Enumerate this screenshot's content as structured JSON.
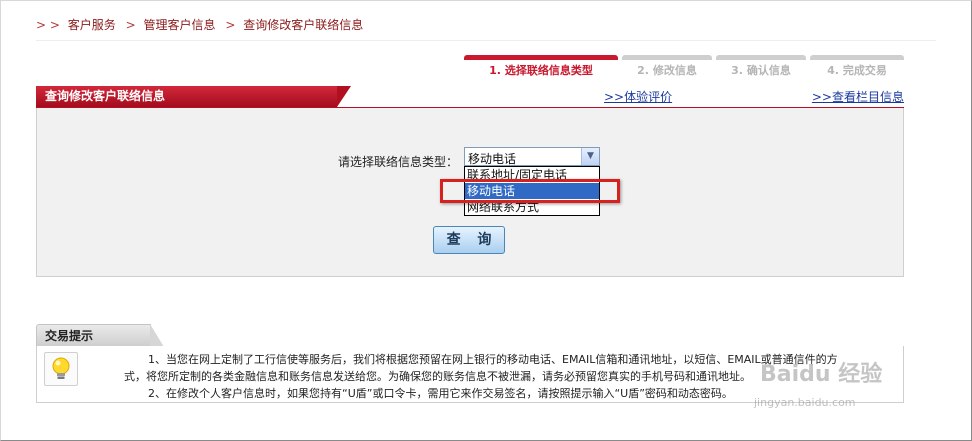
{
  "breadcrumb": {
    "prefix": "> >",
    "items": [
      "客户服务",
      "管理客户信息",
      "查询修改客户联络信息"
    ],
    "separator": ">"
  },
  "steps": [
    {
      "label": "1. 选择联络信息类型",
      "active": true
    },
    {
      "label": "2. 修改信息",
      "active": false
    },
    {
      "label": "3. 确认信息",
      "active": false
    },
    {
      "label": "4. 完成交易",
      "active": false
    }
  ],
  "panel": {
    "title": "查询修改客户联络信息",
    "link_feedback": ">>体验评价",
    "link_column": ">>查看栏目信息"
  },
  "form": {
    "label": "请选择联络信息类型：",
    "selected": "移动电话",
    "options": [
      "联系地址/固定电话",
      "移动电话",
      "网络联系方式"
    ],
    "highlighted_index": 1,
    "query_button": "查 询"
  },
  "tips": {
    "title": "交易提示",
    "line1": "1、当您在网上定制了工行信使等服务后，我们将根据您预留在网上银行的移动电话、EMAIL信箱和通讯地址，以短信、EMAIL或普通信件的方",
    "line2": "式，将您所定制的各类金融信息和账务信息发送给您。为确保您的账务信息不被泄漏，请务必预留您真实的手机号码和通讯地址。",
    "line3": "2、在修改个人客户信息时，如果您持有“U盾”或口令卡，需用它来作交易签名，请按照提示输入“U盾”密码和动态密码。"
  },
  "watermark": {
    "brand": "Baidu 经验",
    "url": "jingyan.baidu.com"
  },
  "colors": {
    "brand_red": "#c8192e",
    "link_blue": "#1a3aa0",
    "select_highlight": "#316ac5",
    "annotation_red": "#d6221e"
  }
}
